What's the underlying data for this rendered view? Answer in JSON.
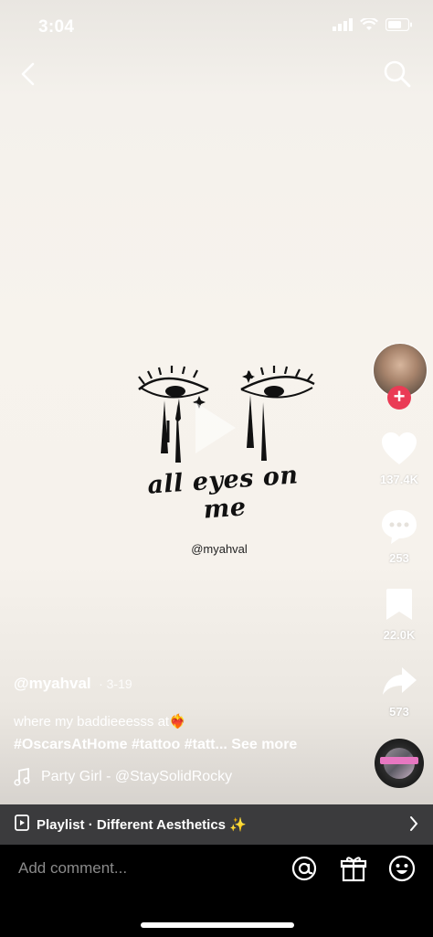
{
  "status": {
    "time": "3:04"
  },
  "artwork": {
    "title": "all eyes on me",
    "handle": "@myahval"
  },
  "rail": {
    "likes": "137.4K",
    "comments": "253",
    "saves": "22.0K",
    "shares": "573"
  },
  "post": {
    "username": "@myahval",
    "date": "· 3-19",
    "description": "where my baddieeesss at❤️‍🔥",
    "tags": "#OscarsAtHome #tattoo #tatt... See more",
    "music": "Party Girl - @StaySolidRocky"
  },
  "playlist": {
    "label": "Playlist · Different Aesthetics ✨"
  },
  "comment": {
    "placeholder": "Add comment..."
  },
  "colors": {
    "accent": "#ea3b55",
    "playlist_bg": "#3b3b3d"
  }
}
